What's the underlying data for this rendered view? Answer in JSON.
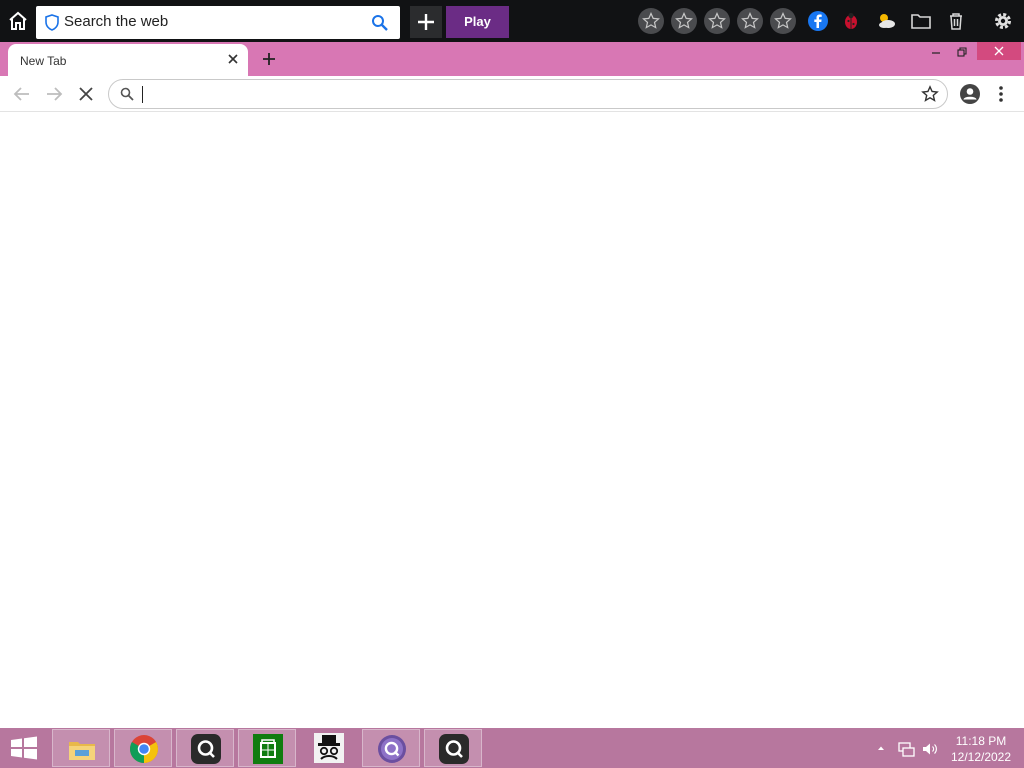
{
  "toolbar": {
    "search_label": "Search the web",
    "play_label": "Play",
    "star_slots": [
      "star-icon",
      "star-icon",
      "star-icon",
      "star-icon",
      "star-icon"
    ],
    "icons": [
      "home-icon",
      "shield-icon",
      "search-icon",
      "plus-icon",
      "facebook-icon",
      "ladybug-icon",
      "weather-icon",
      "folder-icon",
      "trash-icon",
      "gear-icon"
    ],
    "play_color": "#6b2c85"
  },
  "browser": {
    "tab_title": "New Tab",
    "omnibox_value": "",
    "omnibox_placeholder": "",
    "frame_color": "#d877b4",
    "close_color": "#d34a7f"
  },
  "taskbar": {
    "apps": [
      {
        "name": "file-explorer",
        "active": true
      },
      {
        "name": "chrome",
        "active": true
      },
      {
        "name": "app-q-dark",
        "active": true
      },
      {
        "name": "microsoft-store",
        "active": true
      },
      {
        "name": "tophat-app",
        "active": false
      },
      {
        "name": "app-q-purple",
        "active": true
      },
      {
        "name": "app-q-dark-2",
        "active": true
      }
    ],
    "time": "11:18 PM",
    "date": "12/12/2022",
    "color": "#b7779e"
  }
}
